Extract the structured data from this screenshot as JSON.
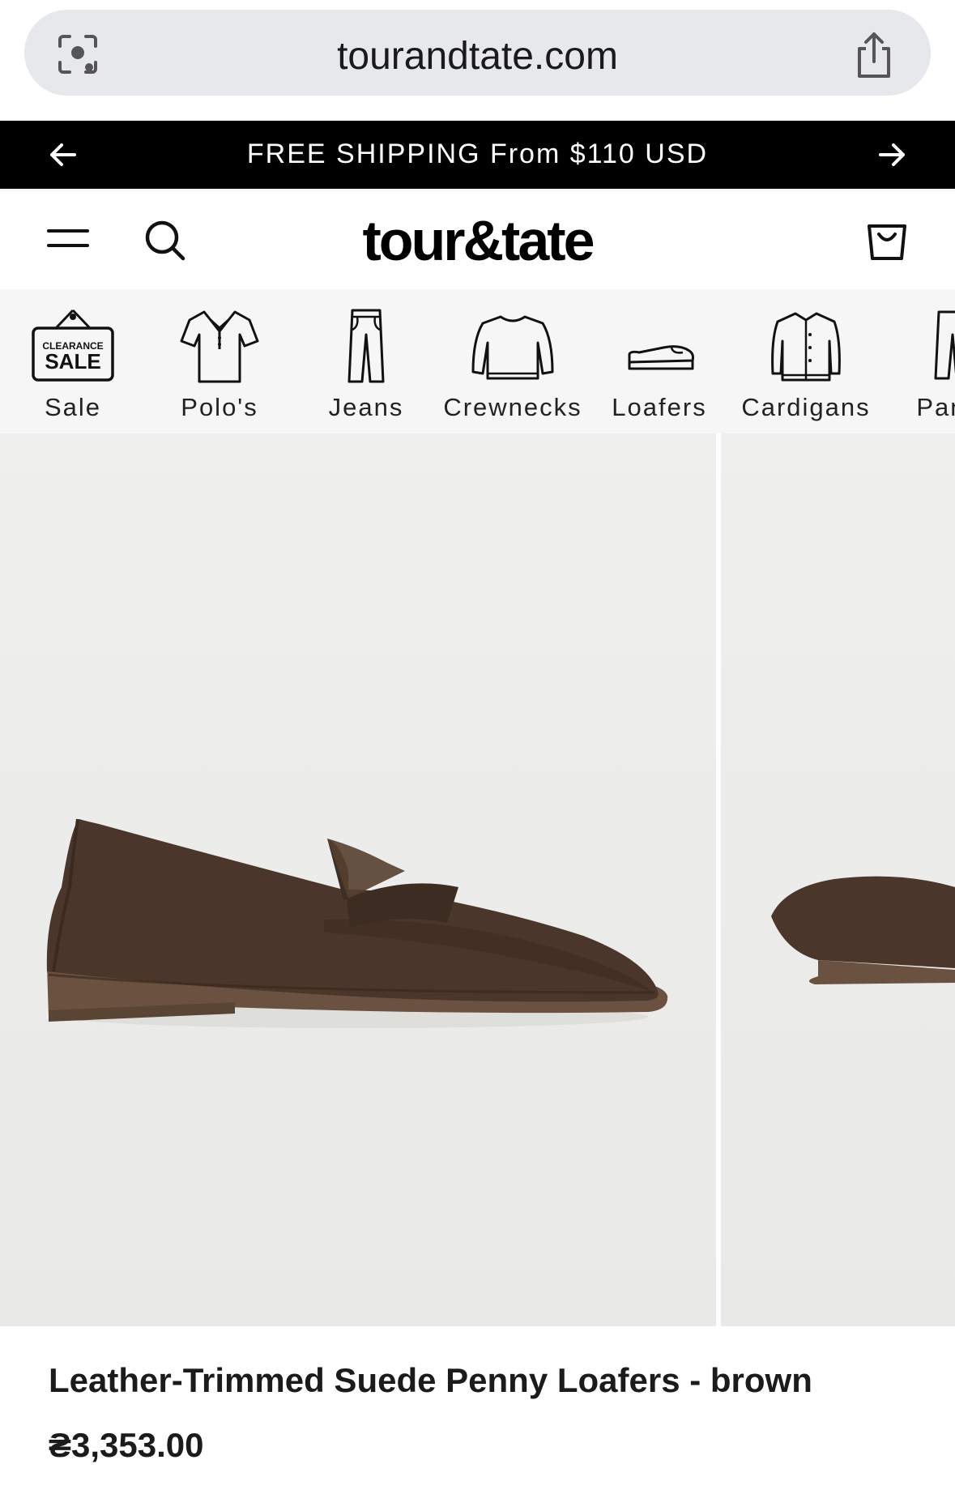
{
  "browser": {
    "url": "tourandtate.com",
    "lens_icon": "camera-search-icon",
    "share_icon": "share-icon"
  },
  "announcement": {
    "text": "FREE SHIPPING From $110 USD",
    "prev_icon": "arrow-left-icon",
    "next_icon": "arrow-right-icon"
  },
  "header": {
    "logo": "tour&tate",
    "menu_icon": "hamburger-icon",
    "search_icon": "search-icon",
    "cart_icon": "shopping-bag-icon"
  },
  "categories": [
    {
      "label": "Sale",
      "icon": "clearance-sale-sign-icon",
      "badge_top": "CLEARANCE",
      "badge_main": "SALE"
    },
    {
      "label": "Polo's",
      "icon": "polo-shirt-icon"
    },
    {
      "label": "Jeans",
      "icon": "jeans-icon"
    },
    {
      "label": "Crewnecks",
      "icon": "sweater-icon"
    },
    {
      "label": "Loafers",
      "icon": "loafer-shoe-icon"
    },
    {
      "label": "Cardigans",
      "icon": "cardigan-icon"
    },
    {
      "label": "Pants",
      "icon": "pants-icon"
    }
  ],
  "product": {
    "name": "Leather-Trimmed Suede Penny Loafers - brown",
    "price": "₴3,353.00",
    "colors": {
      "suede": "#4a362a",
      "sole": "#6b5240",
      "background": "#ecece9"
    }
  }
}
